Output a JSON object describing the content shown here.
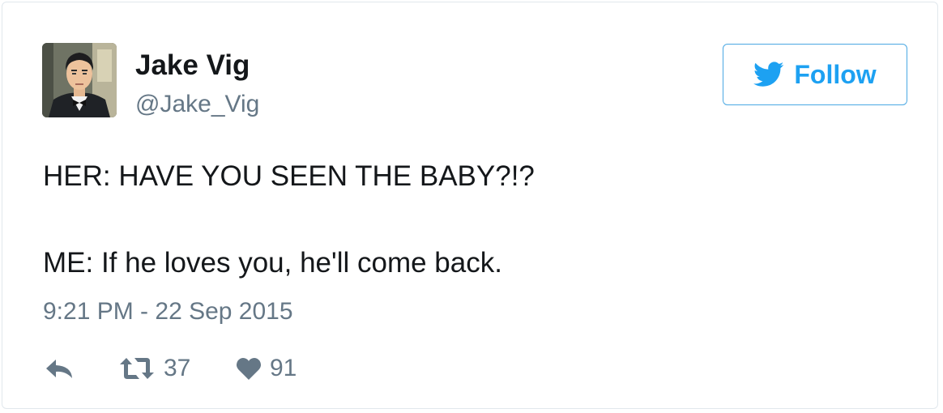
{
  "user": {
    "display_name": "Jake Vig",
    "handle": "@Jake_Vig"
  },
  "follow_button": {
    "label": "Follow"
  },
  "tweet": {
    "lines": [
      "HER: HAVE YOU SEEN THE BABY?!?",
      "ME: If he loves you, he'll come back."
    ],
    "timestamp": "9:21 PM - 22 Sep 2015"
  },
  "actions": {
    "retweet_count": "37",
    "like_count": "91"
  },
  "colors": {
    "accent": "#1da1f2",
    "text": "#14171a",
    "muted": "#657786",
    "border": "#e1e8ed"
  },
  "icons": [
    "avatar",
    "twitter-bird-icon",
    "reply-icon",
    "retweet-icon",
    "heart-icon"
  ]
}
